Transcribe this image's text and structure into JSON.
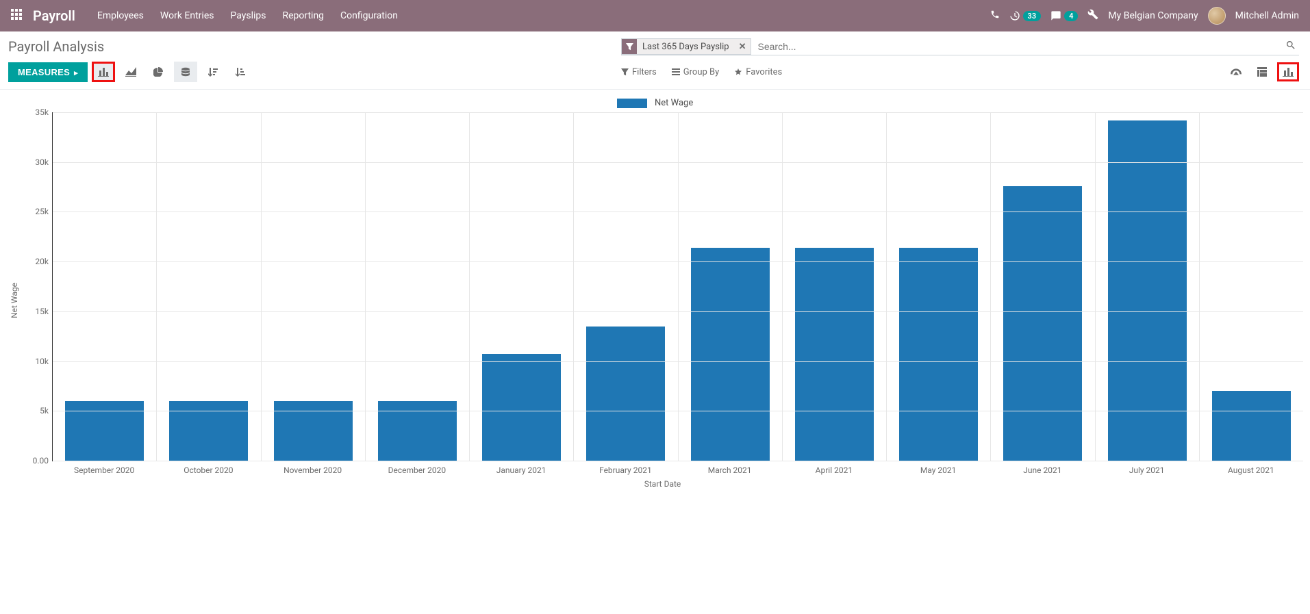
{
  "nav": {
    "brand": "Payroll",
    "menu": [
      "Employees",
      "Work Entries",
      "Payslips",
      "Reporting",
      "Configuration"
    ],
    "badge_activities": "33",
    "badge_messages": "4",
    "company": "My Belgian Company",
    "user": "Mitchell Admin"
  },
  "page": {
    "title": "Payroll Analysis",
    "measures_label": "MEASURES"
  },
  "search": {
    "facet_label": "Last 365 Days Payslip",
    "placeholder": "Search...",
    "opt_filters": "Filters",
    "opt_groupby": "Group By",
    "opt_favorites": "Favorites"
  },
  "chart_data": {
    "type": "bar",
    "title": "",
    "legend": "Net Wage",
    "xlabel": "Start Date",
    "ylabel": "Net Wage",
    "ylim": [
      0,
      35000
    ],
    "y_ticks": [
      0,
      5000,
      10000,
      15000,
      20000,
      25000,
      30000,
      35000
    ],
    "y_tick_labels": [
      "0.00",
      "5k",
      "10k",
      "15k",
      "20k",
      "25k",
      "30k",
      "35k"
    ],
    "categories": [
      "September 2020",
      "October 2020",
      "November 2020",
      "December 2020",
      "January 2021",
      "February 2021",
      "March 2021",
      "April 2021",
      "May 2021",
      "June 2021",
      "July 2021",
      "August 2021"
    ],
    "values": [
      6000,
      6000,
      6000,
      6000,
      10700,
      13500,
      21400,
      21400,
      21400,
      27600,
      34200,
      7000
    ],
    "bar_color": "#1f77b4"
  }
}
